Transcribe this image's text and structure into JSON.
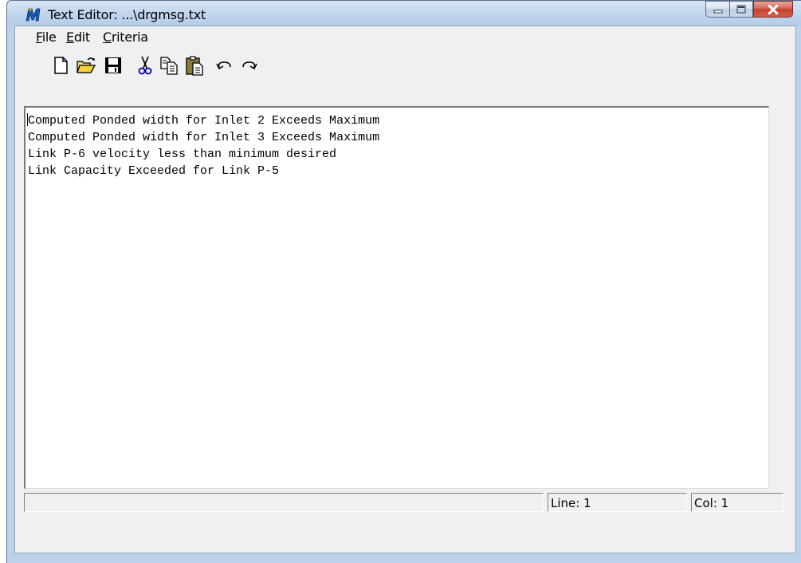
{
  "window": {
    "title": "Text Editor: ...\\drgmsg.txt",
    "icon": "microstation-m-icon",
    "caption_buttons": [
      "minimize-icon",
      "maximize-icon",
      "close-icon"
    ]
  },
  "menu": {
    "items": [
      {
        "label_mn": "F",
        "label_rest": "ile"
      },
      {
        "label_mn": "E",
        "label_rest": "dit"
      },
      {
        "label_mn": "C",
        "label_rest": "riteria"
      }
    ]
  },
  "toolbar": {
    "icons": [
      "new-file-icon",
      "open-folder-icon",
      "save-icon",
      "cut-icon",
      "copy-icon",
      "paste-icon",
      "undo-icon",
      "redo-icon"
    ]
  },
  "editor": {
    "lines": [
      "Computed Ponded width for Inlet 2 Exceeds Maximum",
      "Computed Ponded width for Inlet 3 Exceeds Maximum",
      "Link P-6 velocity less than minimum desired",
      "Link Capacity Exceeded for Link P-5"
    ]
  },
  "status": {
    "message": "",
    "line": "Line: 1",
    "col": "Col: 1"
  },
  "colors": {
    "frame": "#bcd1ea",
    "client": "#f0f0f0",
    "close_button": "#c3412e"
  }
}
